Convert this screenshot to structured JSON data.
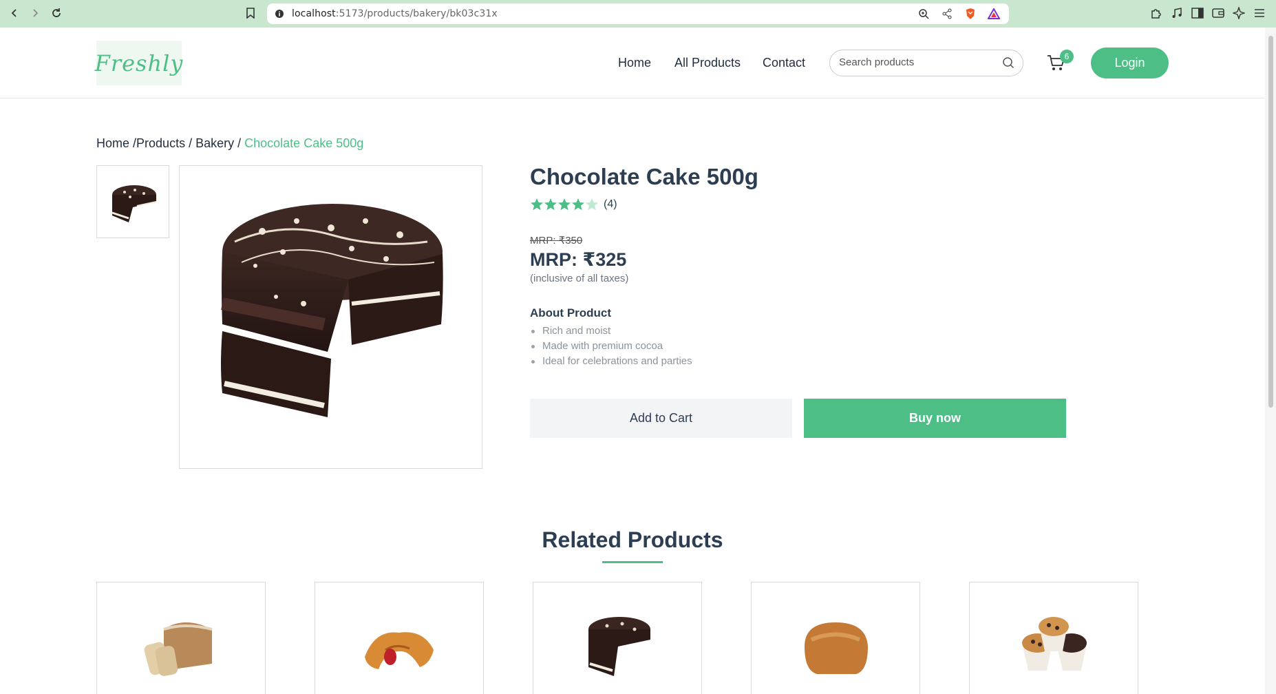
{
  "browser": {
    "url_host": "localhost",
    "url_path": ":5173/products/bakery/bk03c31x"
  },
  "header": {
    "logo_text": "Freshly",
    "nav": [
      {
        "label": "Home"
      },
      {
        "label": "All Products"
      },
      {
        "label": "Contact"
      }
    ],
    "search": {
      "placeholder": "Search products",
      "value": ""
    },
    "cart_count": "6",
    "login_label": "Login"
  },
  "breadcrumb": {
    "home": "Home",
    "sep1": " /",
    "products": "Products",
    "sep2": " / ",
    "category": "Bakery",
    "sep3": " / ",
    "current": "Chocolate Cake 500g"
  },
  "product": {
    "title": "Chocolate Cake 500g",
    "rating": 4,
    "rating_count": "(4)",
    "old_price": "MRP: ₹350",
    "price": "MRP: ₹325",
    "tax_note": "(inclusive of all taxes)",
    "about_title": "About Product",
    "about_points": [
      "Rich and moist",
      "Made with premium cocoa",
      "Ideal for celebrations and parties"
    ],
    "add_to_cart": "Add to Cart",
    "buy_now": "Buy now"
  },
  "related": {
    "title": "Related Products",
    "items": [
      {
        "icon": "bread-loaf-sliced"
      },
      {
        "icon": "croissant"
      },
      {
        "icon": "chocolate-cake"
      },
      {
        "icon": "bread-loaf"
      },
      {
        "icon": "muffins"
      }
    ]
  },
  "colors": {
    "accent": "#4dbf86",
    "text": "#2e3e52",
    "chrome": "#c9e6cf"
  }
}
